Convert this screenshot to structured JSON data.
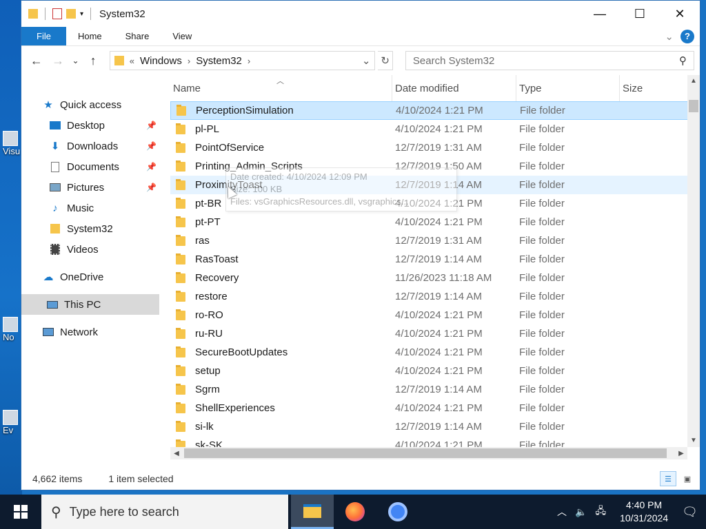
{
  "window": {
    "title": "System32",
    "controls": {
      "minimize": "—",
      "maximize": "☐",
      "close": "✕"
    }
  },
  "ribbon": {
    "tabs": [
      "File",
      "Home",
      "Share",
      "View"
    ],
    "expand_icon": "chevron-down-icon",
    "help_label": "?"
  },
  "address": {
    "overflow": "«",
    "crumbs": [
      "Windows",
      "System32"
    ],
    "search_placeholder": "Search System32"
  },
  "nav_pane": {
    "quick_access": "Quick access",
    "pinned": [
      {
        "label": "Desktop",
        "icon": "desktop-icon",
        "pinned": true
      },
      {
        "label": "Downloads",
        "icon": "downloads-icon",
        "pinned": true
      },
      {
        "label": "Documents",
        "icon": "documents-icon",
        "pinned": true
      },
      {
        "label": "Pictures",
        "icon": "pictures-icon",
        "pinned": true
      },
      {
        "label": "Music",
        "icon": "music-icon",
        "pinned": false
      },
      {
        "label": "System32",
        "icon": "folder-icon",
        "pinned": false
      },
      {
        "label": "Videos",
        "icon": "videos-icon",
        "pinned": false
      }
    ],
    "onedrive": "OneDrive",
    "this_pc": "This PC",
    "network": "Network"
  },
  "columns": {
    "name": "Name",
    "date": "Date modified",
    "type": "Type",
    "size": "Size"
  },
  "files": [
    {
      "name": "PerceptionSimulation",
      "date": "4/10/2024 1:21 PM",
      "type": "File folder"
    },
    {
      "name": "pl-PL",
      "date": "4/10/2024 1:21 PM",
      "type": "File folder"
    },
    {
      "name": "PointOfService",
      "date": "12/7/2019 1:31 AM",
      "type": "File folder"
    },
    {
      "name": "Printing_Admin_Scripts",
      "date": "12/7/2019 1:50 AM",
      "type": "File folder"
    },
    {
      "name": "ProximityToast",
      "date": "12/7/2019 1:14 AM",
      "type": "File folder"
    },
    {
      "name": "pt-BR",
      "date": "4/10/2024 1:21 PM",
      "type": "File folder"
    },
    {
      "name": "pt-PT",
      "date": "4/10/2024 1:21 PM",
      "type": "File folder"
    },
    {
      "name": "ras",
      "date": "12/7/2019 1:31 AM",
      "type": "File folder"
    },
    {
      "name": "RasToast",
      "date": "12/7/2019 1:14 AM",
      "type": "File folder"
    },
    {
      "name": "Recovery",
      "date": "11/26/2023 11:18 AM",
      "type": "File folder"
    },
    {
      "name": "restore",
      "date": "12/7/2019 1:14 AM",
      "type": "File folder"
    },
    {
      "name": "ro-RO",
      "date": "4/10/2024 1:21 PM",
      "type": "File folder"
    },
    {
      "name": "ru-RU",
      "date": "4/10/2024 1:21 PM",
      "type": "File folder"
    },
    {
      "name": "SecureBootUpdates",
      "date": "4/10/2024 1:21 PM",
      "type": "File folder"
    },
    {
      "name": "setup",
      "date": "4/10/2024 1:21 PM",
      "type": "File folder"
    },
    {
      "name": "Sgrm",
      "date": "12/7/2019 1:14 AM",
      "type": "File folder"
    },
    {
      "name": "ShellExperiences",
      "date": "4/10/2024 1:21 PM",
      "type": "File folder"
    },
    {
      "name": "si-lk",
      "date": "12/7/2019 1:14 AM",
      "type": "File folder"
    },
    {
      "name": "sk-SK",
      "date": "4/10/2024 1:21 PM",
      "type": "File folder"
    }
  ],
  "tooltip": {
    "created": "Date created: 4/10/2024 12:09 PM",
    "size": "Size: 100 KB",
    "files": "Files: vsGraphicsResources.dll, vsgraphics..."
  },
  "status": {
    "count": "4,662 items",
    "selected": "1 item selected"
  },
  "taskbar": {
    "search_placeholder": "Type here to search",
    "time": "4:40 PM",
    "date": "10/31/2024"
  },
  "desktop_labels": [
    "Visu",
    "No",
    "Ev"
  ]
}
